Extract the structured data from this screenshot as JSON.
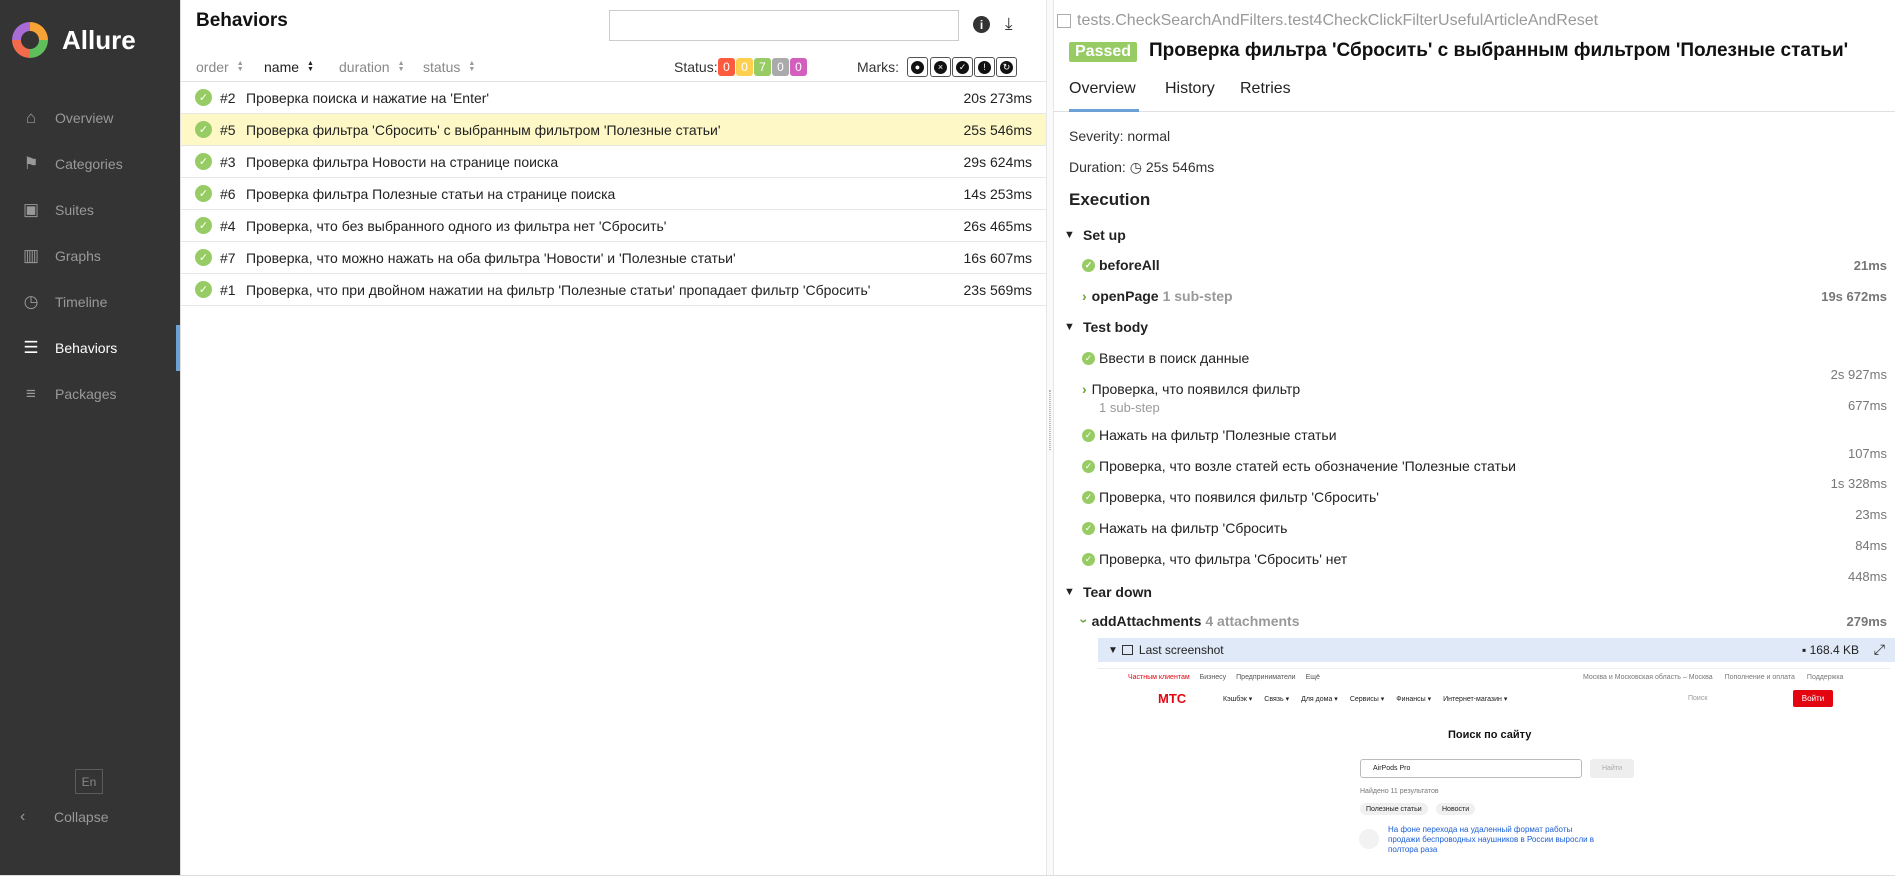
{
  "app": {
    "name": "Allure"
  },
  "sidebar": {
    "items": [
      {
        "label": "Overview",
        "icon": "home-icon",
        "glyph": "⌂"
      },
      {
        "label": "Categories",
        "icon": "flag-icon",
        "glyph": "⚑"
      },
      {
        "label": "Suites",
        "icon": "briefcase-icon",
        "glyph": "▣"
      },
      {
        "label": "Graphs",
        "icon": "bar-chart-icon",
        "glyph": "▥"
      },
      {
        "label": "Timeline",
        "icon": "clock-icon",
        "glyph": "◷"
      },
      {
        "label": "Behaviors",
        "icon": "list-icon",
        "glyph": "☰",
        "active": true
      },
      {
        "label": "Packages",
        "icon": "align-icon",
        "glyph": "≡"
      }
    ],
    "language": "En",
    "collapse_label": "Collapse"
  },
  "behaviors": {
    "title": "Behaviors",
    "search_value": "",
    "columns": {
      "order": "order",
      "name": "name",
      "duration": "duration",
      "status": "status"
    },
    "status_label": "Status:",
    "status_counts": [
      {
        "value": "0",
        "color": "#fd5a3e"
      },
      {
        "value": "0",
        "color": "#ffd050"
      },
      {
        "value": "7",
        "color": "#97cc64"
      },
      {
        "value": "0",
        "color": "#aaaaaa"
      },
      {
        "value": "0",
        "color": "#d35ebe"
      }
    ],
    "marks_label": "Marks:",
    "rows": [
      {
        "order": "#2",
        "name": "Проверка поиска и нажатие на 'Enter'",
        "duration": "20s 273ms"
      },
      {
        "order": "#5",
        "name": "Проверка фильтра 'Сбросить' с выбранным фильтром 'Полезные статьи'",
        "duration": "25s 546ms",
        "active": true
      },
      {
        "order": "#3",
        "name": "Проверка фильтра Новости на странице поиска",
        "duration": "29s 624ms"
      },
      {
        "order": "#6",
        "name": "Проверка фильтра Полезные статьи на странице поиска",
        "duration": "14s 253ms"
      },
      {
        "order": "#4",
        "name": "Проверка, что без выбранного одного из фильтра нет 'Сбросить'",
        "duration": "26s 465ms"
      },
      {
        "order": "#7",
        "name": "Проверка, что можно нажать на оба фильтра 'Новости' и 'Полезные статьи'",
        "duration": "16s 607ms"
      },
      {
        "order": "#1",
        "name": "Проверка, что при двойном нажатии на фильтр 'Полезные статьи' пропадает фильтр 'Сбросить'",
        "duration": "23s 569ms"
      }
    ]
  },
  "detail": {
    "path": "tests.CheckSearchAndFilters.test4CheckClickFilterUsefulArticleAndReset",
    "status": "Passed",
    "title": "Проверка фильтра 'Сбросить' с выбранным фильтром 'Полезные статьи'",
    "tabs": [
      "Overview",
      "History",
      "Retries"
    ],
    "severity": "Severity: normal",
    "duration_label": "Duration:",
    "duration": "25s 546ms",
    "execution_title": "Execution",
    "setup_label": "Set up",
    "testbody_label": "Test body",
    "teardown_label": "Tear down",
    "setup_steps": [
      {
        "name": "beforeAll",
        "duration": "21ms"
      },
      {
        "name": "openPage",
        "sub": "1 sub-step",
        "duration": "19s 672ms"
      }
    ],
    "body_steps": [
      {
        "name": "Ввести в поиск данные",
        "duration": "2s 927ms"
      },
      {
        "name": "Проверка, что появился фильтр",
        "sub": "1 sub-step",
        "duration": "677ms"
      },
      {
        "name": "Нажать на фильтр 'Полезные статьи",
        "duration": "107ms"
      },
      {
        "name": "Проверка, что возле статей есть обозначение 'Полезные статьи",
        "duration": "1s 328ms"
      },
      {
        "name": "Проверка, что появился фильтр 'Сбросить'",
        "duration": "23ms"
      },
      {
        "name": "Нажать на фильтр 'Сбросить",
        "duration": "84ms"
      },
      {
        "name": "Проверка, что фильтра 'Сбросить' нет",
        "duration": "448ms"
      }
    ],
    "teardown_step": {
      "name": "addAttachments",
      "sub": "4 attachments",
      "duration": "279ms"
    },
    "attachment": {
      "name": "Last screenshot",
      "size": "168.4 KB"
    }
  },
  "screenshot": {
    "topline": [
      "Частным клиентам",
      "Бизнесу",
      "Предприниматели",
      "Ещё"
    ],
    "topright": [
      "Москва и Московская область – Москва",
      "Пополнение и оплата",
      "Поддержка"
    ],
    "brand": "МТС",
    "menu": [
      "Кэшбэк ▾",
      "Связь ▾",
      "Для дома ▾",
      "Сервисы ▾",
      "Финансы ▾",
      "Интернет-магазин ▾"
    ],
    "find_site": "Поиск",
    "login": "Войти",
    "heading": "Поиск по сайту",
    "query": "AirPods Pro",
    "find_button": "Найти",
    "found": "Найдено 11 результатов",
    "chips": [
      "Полезные статьи",
      "Новости"
    ],
    "article": "На фоне перехода на удаленный формат работы продажи беспроводных наушников в России выросли в полтора раза"
  }
}
